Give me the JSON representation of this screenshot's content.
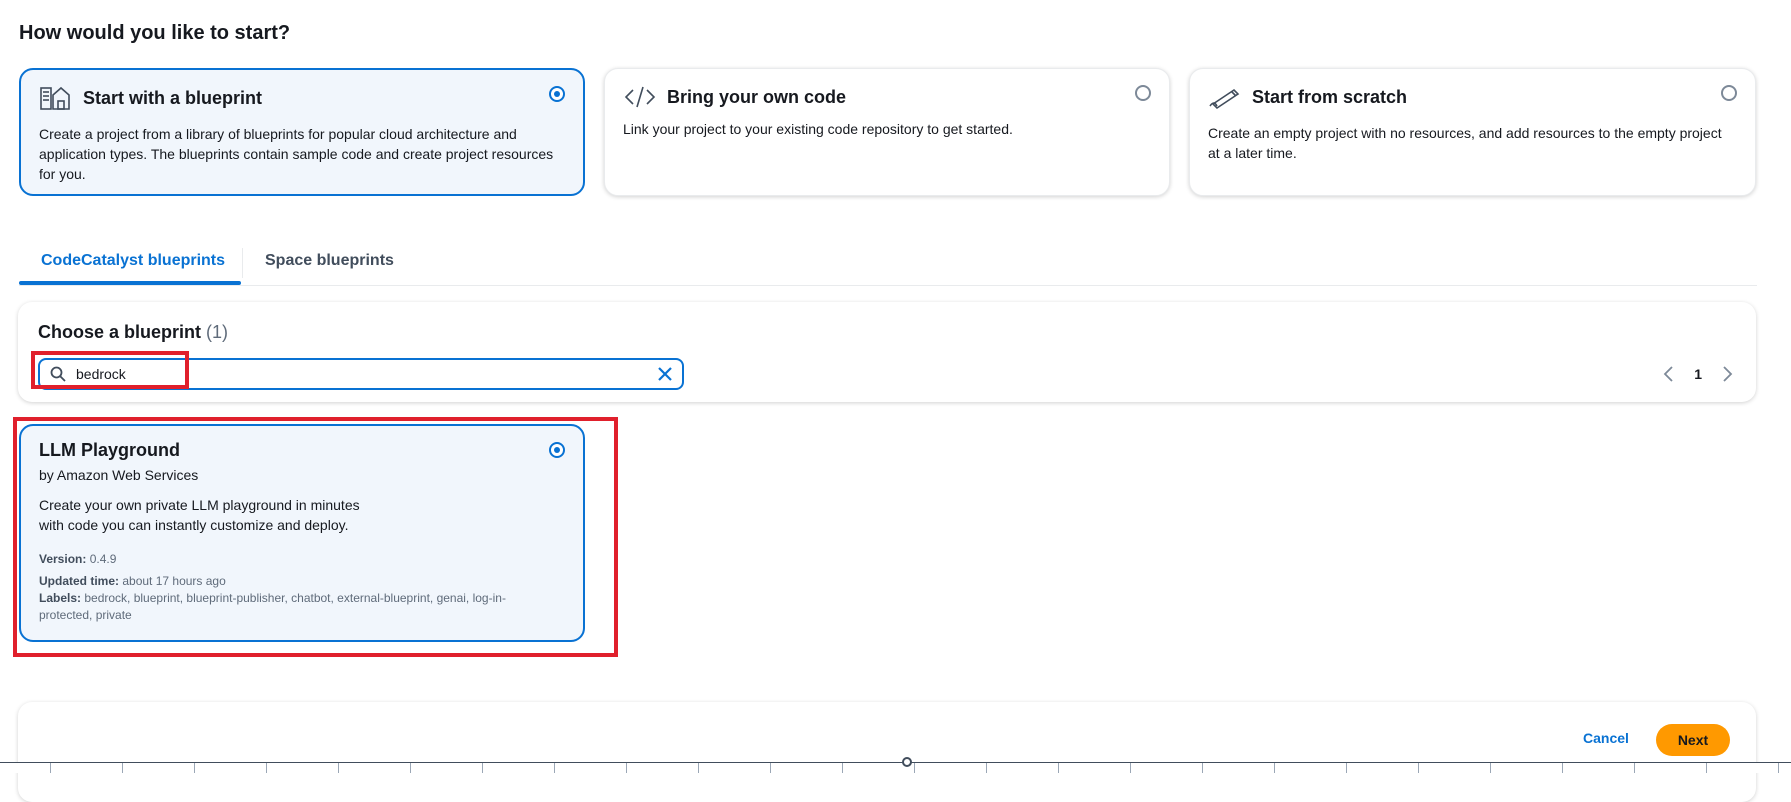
{
  "page": {
    "heading": "How would you like to start?"
  },
  "start_options": [
    {
      "title": "Start with a blueprint",
      "description": "Create a project from a library of blueprints for popular cloud architecture and application types. The blueprints contain sample code and create project resources for you.",
      "selected": true,
      "icon": "blueprint-icon"
    },
    {
      "title": "Bring your own code",
      "description": "Link your project to your existing code repository to get started.",
      "selected": false,
      "icon": "code-icon"
    },
    {
      "title": "Start from scratch",
      "description": "Create an empty project with no resources, and add resources to the empty project at a later time.",
      "selected": false,
      "icon": "pencil-icon"
    }
  ],
  "tabs": [
    {
      "label": "CodeCatalyst blueprints",
      "active": true
    },
    {
      "label": "Space blueprints",
      "active": false
    }
  ],
  "chooser": {
    "title": "Choose a blueprint",
    "count": "(1)",
    "search_value": "bedrock",
    "page_number": "1"
  },
  "blueprint_card": {
    "title": "LLM Playground",
    "author": "by Amazon Web Services",
    "description_line1": "Create your own private LLM playground in minutes",
    "description_line2": "with code you can instantly customize and deploy.",
    "version_label": "Version:",
    "version_value": "0.4.9",
    "updated_label": "Updated time:",
    "updated_value": "about 17 hours ago",
    "labels_label": "Labels:",
    "labels_value": "bedrock, blueprint, blueprint-publisher, chatbot, external-blueprint, genai, log-in-protected, private",
    "selected": true
  },
  "footer": {
    "cancel_label": "Cancel",
    "next_label": "Next"
  },
  "colors": {
    "accent": "#0972d3",
    "primary_button": "#ff9900",
    "highlight": "#e0202c"
  }
}
